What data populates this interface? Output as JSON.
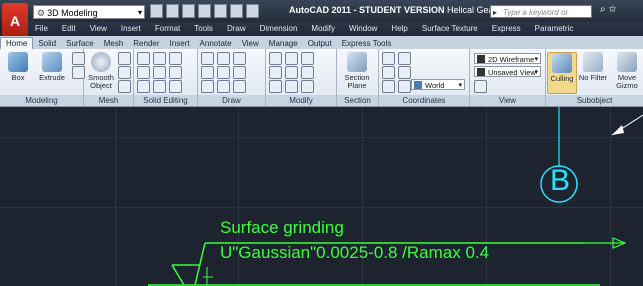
{
  "titlebar": {
    "app_button": "A",
    "workspace": "3D Modeling",
    "title": "AutoCAD 2011 - STUDENT VERSION",
    "filename": "Helical Gear.dwg",
    "search_placeholder": "Type a keyword or phrase",
    "icons": [
      "binoculars-icon",
      "star-icon",
      "help-icon"
    ]
  },
  "menu": [
    "File",
    "Edit",
    "View",
    "Insert",
    "Format",
    "Tools",
    "Draw",
    "Dimension",
    "Modify",
    "Window",
    "Help",
    "Surface Texture",
    "Express",
    "Parametric"
  ],
  "tabs": [
    "Home",
    "Solid",
    "Surface",
    "Mesh",
    "Render",
    "Insert",
    "Annotate",
    "View",
    "Manage",
    "Output",
    "Express Tools"
  ],
  "ribbon": {
    "box": "Box",
    "extrude": "Extrude",
    "smooth_object": "Smooth Object",
    "section_plane": "Section Plane",
    "visual_style": "2D Wireframe",
    "view": "Unsaved View",
    "ucs": "World",
    "culling": "Culling",
    "no_filter": "No Filter",
    "move_gizmo": "Move Gizmo",
    "panels": [
      "Modeling",
      "Mesh",
      "Solid Editing",
      "Draw",
      "Modify",
      "Section",
      "Coordinates",
      "View",
      "Subobject"
    ]
  },
  "canvas": {
    "balloon": "B",
    "line1": "Surface grinding",
    "line2": "U\"Gaussian\"0.0025-0.8 /Ramax 0.4"
  },
  "colors": {
    "canvas_bg": "#1d2430",
    "green": "#3cff3c",
    "cyan": "#27e3ff",
    "accent": "#c8d3e2"
  }
}
